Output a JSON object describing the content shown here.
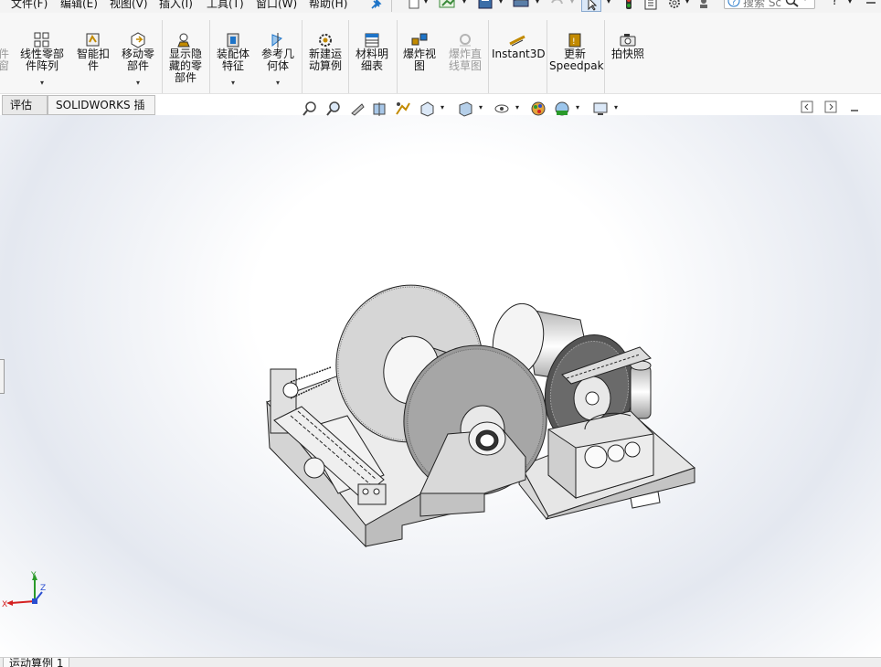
{
  "menu": {
    "items": [
      "文件(F)",
      "编辑(E)",
      "视图(V)",
      "插入(I)",
      "工具(T)",
      "窗口(W)",
      "帮助(H)"
    ]
  },
  "top_toolbar": {
    "search_placeholder": "搜索 Sc",
    "help_label": "?"
  },
  "ribbon": {
    "partial_left_label": "件\n窗",
    "buttons": [
      {
        "id": "linear-pattern",
        "label": "线性零部\n件阵列",
        "icon": "linear-pattern-icon"
      },
      {
        "id": "smart-fastener",
        "label": "智能扣\n件",
        "icon": "smart-fastener-icon"
      },
      {
        "id": "move-component",
        "label": "移动零\n部件",
        "icon": "move-component-icon"
      },
      {
        "id": "show-hidden",
        "label": "显示隐\n藏的零\n部件",
        "icon": "show-hidden-icon"
      },
      {
        "id": "assembly-features",
        "label": "装配体\n特征",
        "icon": "assembly-feature-icon"
      },
      {
        "id": "reference-geometry",
        "label": "参考几\n何体",
        "icon": "reference-geometry-icon"
      },
      {
        "id": "new-motion-study",
        "label": "新建运\n动算例",
        "icon": "motion-study-icon"
      },
      {
        "id": "bom",
        "label": "材料明\n细表",
        "icon": "bom-icon"
      },
      {
        "id": "exploded-view",
        "label": "爆炸视\n图",
        "icon": "exploded-view-icon"
      },
      {
        "id": "explode-line-sketch",
        "label": "爆炸直\n线草图",
        "icon": "explode-line-icon",
        "disabled": true
      },
      {
        "id": "instant3d",
        "label": "Instant3D",
        "icon": "instant3d-icon"
      },
      {
        "id": "update-speedpak",
        "label": "更新\nSpeedpak",
        "icon": "speedpak-icon"
      },
      {
        "id": "snapshot",
        "label": "拍快照",
        "icon": "camera-icon"
      }
    ]
  },
  "tabs": [
    {
      "label": "评估"
    },
    {
      "label": "SOLIDWORKS 插件"
    }
  ],
  "triad": {
    "x": "X",
    "y": "Y",
    "z": "Z"
  },
  "bottom_tabs": [
    "运动算例 1"
  ],
  "colors": {
    "accent_blue": "#1e74c8",
    "triad_x": "#d42020",
    "triad_y": "#2a9a2a",
    "triad_z": "#2a4ed0",
    "model_gray": "#d6d6d6"
  }
}
